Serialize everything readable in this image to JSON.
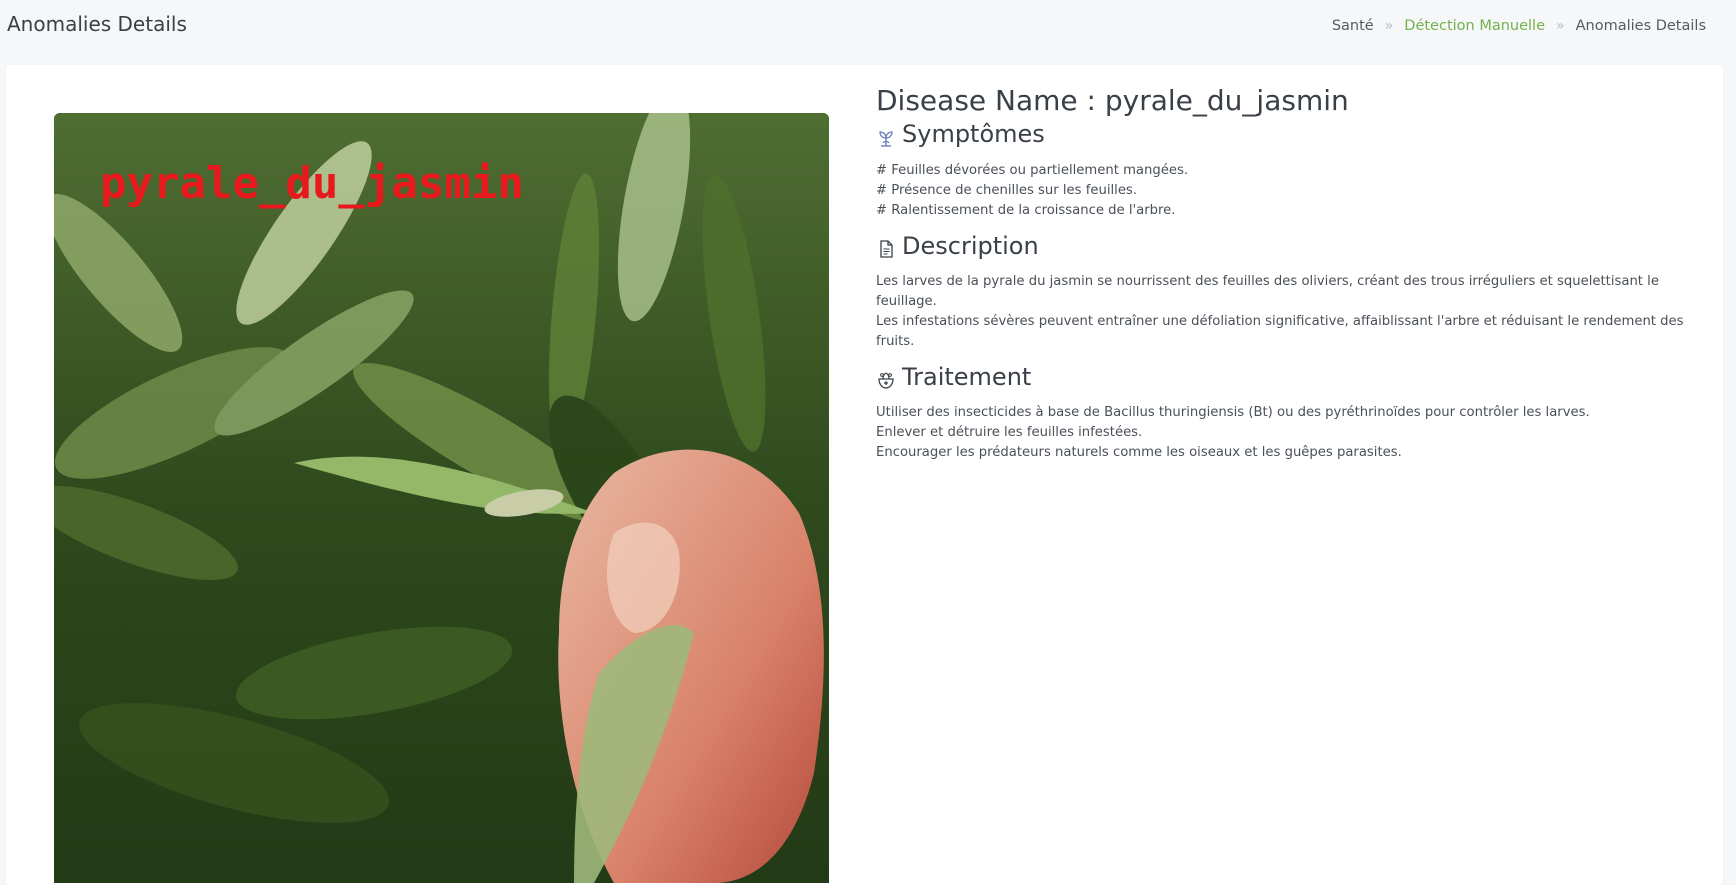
{
  "header": {
    "title": "Anomalies Details",
    "breadcrumb": {
      "items": [
        "Santé",
        "Détection Manuelle",
        "Anomalies Details"
      ],
      "separator": "»"
    }
  },
  "image": {
    "overlay_label": "pyrale_du_jasmin",
    "overlay_color": "#e8191c"
  },
  "details": {
    "title_prefix": "Disease Name : ",
    "disease_name": "pyrale_du_jasmin",
    "symptoms": {
      "heading": "Symptômes",
      "icon": "sprout-icon",
      "lines": [
        "# Feuilles dévorées ou partiellement mangées.",
        "# Présence de chenilles sur les feuilles.",
        "# Ralentissement de la croissance de l'arbre."
      ]
    },
    "description": {
      "heading": "Description",
      "icon": "document-icon",
      "lines": [
        "Les larves de la pyrale du jasmin se nourrissent des feuilles des oliviers, créant des trous irréguliers et squelettisant le feuillage.",
        "Les infestations sévères peuvent entraîner une défoliation significative, affaiblissant l'arbre et réduisant le rendement des fruits."
      ]
    },
    "treatment": {
      "heading": "Traitement",
      "icon": "medicine-pot-icon",
      "lines": [
        "Utiliser des insecticides à base de Bacillus thuringiensis (Bt) ou des pyréthrinoïdes pour contrôler les larves.",
        "Enlever et détruire les feuilles infestées.",
        "Encourager les prédateurs naturels comme les oiseaux et les guêpes parasites."
      ]
    }
  },
  "colors": {
    "accent_green": "#74b14a",
    "background": "#f5f7f9",
    "card": "#ffffff"
  }
}
